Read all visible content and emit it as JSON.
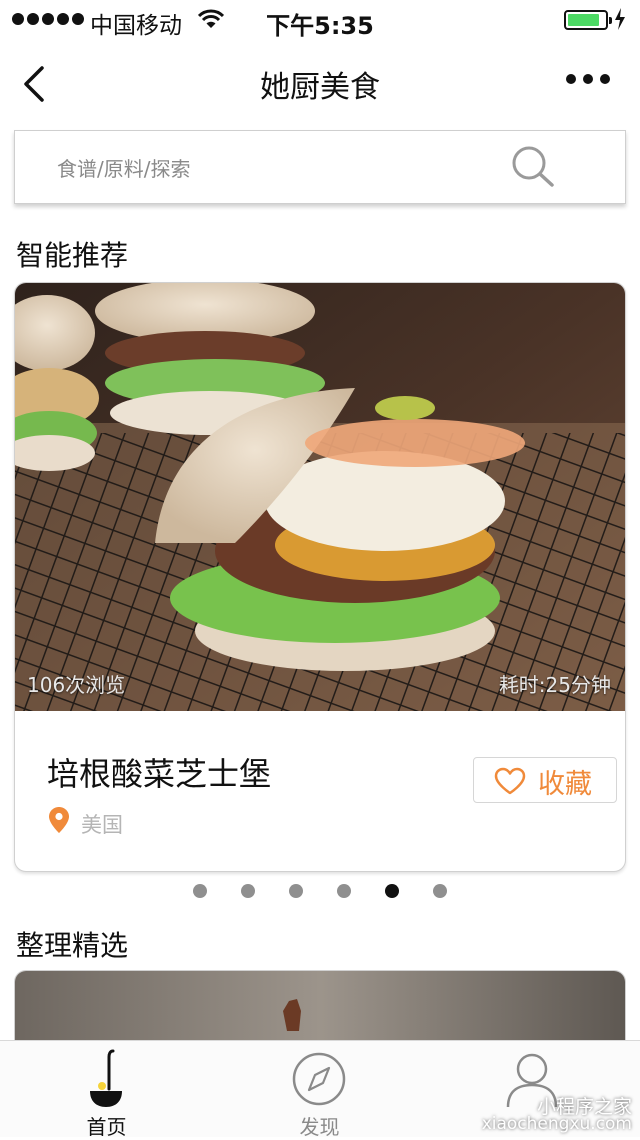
{
  "status_bar": {
    "carrier": "中国移动",
    "time": "下午5:35",
    "battery_level": 0.85,
    "battery_color": "#4cd964"
  },
  "nav": {
    "title": "她厨美食"
  },
  "search": {
    "placeholder": "食谱/原料/探索"
  },
  "sections": {
    "recommend_title": "智能推荐",
    "curated_title": "整理精选"
  },
  "recommend_card": {
    "views": "106次浏览",
    "duration": "耗时:25分钟",
    "name": "培根酸菜芝士堡",
    "location": "美国",
    "favorite_label": "收藏",
    "accent_color": "#f08a3a"
  },
  "carousel": {
    "count": 6,
    "active_index": 4
  },
  "tab_bar": {
    "tabs": [
      {
        "label": "首页",
        "icon": "ladle-icon",
        "active": true
      },
      {
        "label": "发现",
        "icon": "compass-icon",
        "active": false
      },
      {
        "label": "",
        "icon": "user-icon",
        "active": false
      }
    ]
  },
  "watermark": {
    "cn": "小程序之家",
    "en": "xiaochengxu.com"
  }
}
